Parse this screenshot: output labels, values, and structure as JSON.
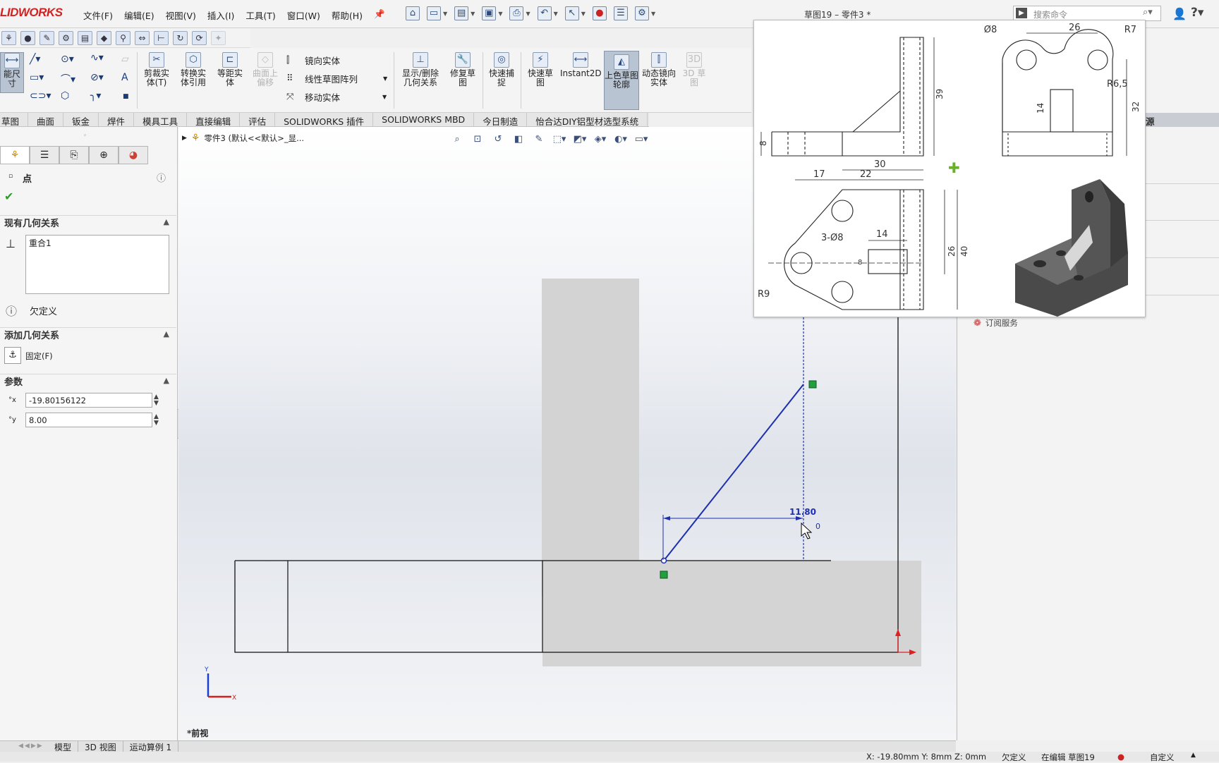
{
  "app": {
    "logo": "LIDWORKS",
    "doc_title": "草图19 – 零件3 *"
  },
  "menu": [
    "文件(F)",
    "编辑(E)",
    "视图(V)",
    "插入(I)",
    "工具(T)",
    "窗口(W)",
    "帮助(H)"
  ],
  "search": {
    "placeholder": "搜索命令"
  },
  "ribbon": {
    "smart_dim": "能尺寸",
    "trim": "剪裁实体(T)",
    "convert": "转换实体引用",
    "offset": "等距实体",
    "surface_offset": "曲面上偏移",
    "mirror": "镜向实体",
    "linear_pattern": "线性草图阵列",
    "move": "移动实体",
    "display_relations": "显示/删除几何关系",
    "repair": "修复草图",
    "quick_snap": "快速捕捉",
    "rapid_sketch": "快速草图",
    "instant2d": "Instant2D",
    "shaded_contour": "上色草图轮廓",
    "dynamic_mirror": "动态镜向实体",
    "sketch3d": "3D 草图"
  },
  "tabs": [
    "草图",
    "曲面",
    "钣金",
    "焊件",
    "模具工具",
    "直接编辑",
    "评估",
    "SOLIDWORKS 插件",
    "SOLIDWORKS MBD",
    "今日制造",
    "怡合达DIY铝型材选型系统"
  ],
  "property_manager": {
    "title": "点",
    "existing_relations_header": "现有几何关系",
    "existing_relations": [
      "重合1"
    ],
    "status": "欠定义",
    "add_relations_header": "添加几何关系",
    "fix_label": "固定(F)",
    "params_header": "参数",
    "x_value": "-19.80156122",
    "y_value": "8.00"
  },
  "breadcrumb": "零件3 (默认<<默认>_显...",
  "right_pane": {
    "header": "源",
    "item": "订阅服务"
  },
  "view_label": "*前视",
  "bottom_tabs": [
    "模型",
    "3D 视图",
    "运动算例 1"
  ],
  "status_bar": {
    "coords": "X: -19.80mm Y: 8mm Z: 0mm",
    "state": "欠定义",
    "editing": "在编辑 草图19",
    "custom": "自定义"
  },
  "sketch": {
    "dimension": "11.80",
    "fix_marker_label": "0"
  },
  "drawing": {
    "top_view": {
      "thickness": "8",
      "height": "39"
    },
    "side_view": {
      "dia": "Ø8",
      "width": "26",
      "radius1": "R7",
      "radius2": "R6,5",
      "slot": "14",
      "height": "32"
    },
    "plan_view": {
      "d17": "17",
      "d30": "30",
      "d22": "22",
      "holes": "3-Ø8",
      "slot": "14",
      "slot_w": "8",
      "d26": "26",
      "d40": "40",
      "radius": "R9"
    }
  }
}
